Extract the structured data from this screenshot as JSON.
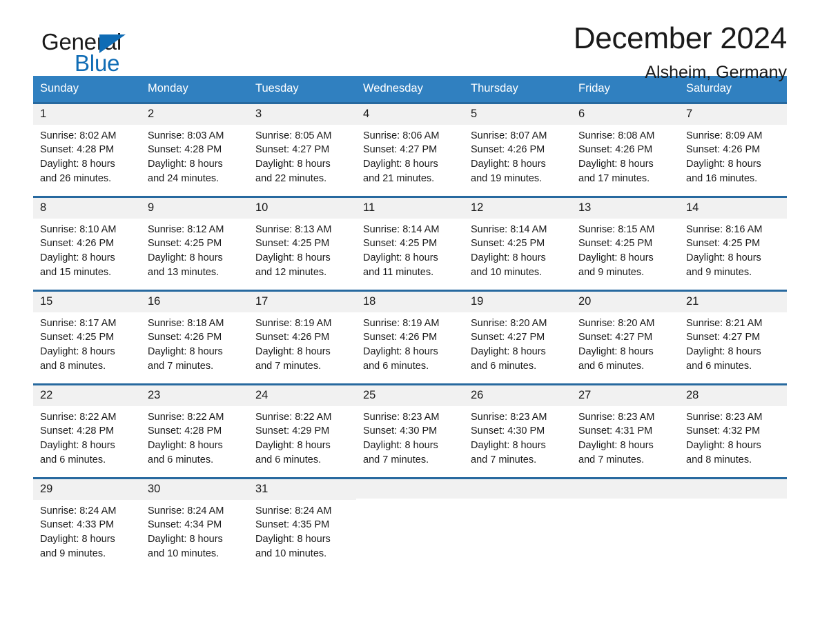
{
  "brand": {
    "name_top": "General",
    "name_bottom": "Blue",
    "accent_color": "#0f6cb5"
  },
  "header": {
    "title": "December 2024",
    "subtitle": "Alsheim, Germany"
  },
  "theme": {
    "header_row_bg": "#3080c0",
    "week_divider": "#27699f",
    "day_number_bg": "#f1f1f1",
    "text": "#1a1a1a"
  },
  "weekdays": [
    "Sunday",
    "Monday",
    "Tuesday",
    "Wednesday",
    "Thursday",
    "Friday",
    "Saturday"
  ],
  "weeks": [
    [
      {
        "day": "1",
        "sunrise": "Sunrise: 8:02 AM",
        "sunset": "Sunset: 4:28 PM",
        "daylight_l1": "Daylight: 8 hours",
        "daylight_l2": "and 26 minutes."
      },
      {
        "day": "2",
        "sunrise": "Sunrise: 8:03 AM",
        "sunset": "Sunset: 4:28 PM",
        "daylight_l1": "Daylight: 8 hours",
        "daylight_l2": "and 24 minutes."
      },
      {
        "day": "3",
        "sunrise": "Sunrise: 8:05 AM",
        "sunset": "Sunset: 4:27 PM",
        "daylight_l1": "Daylight: 8 hours",
        "daylight_l2": "and 22 minutes."
      },
      {
        "day": "4",
        "sunrise": "Sunrise: 8:06 AM",
        "sunset": "Sunset: 4:27 PM",
        "daylight_l1": "Daylight: 8 hours",
        "daylight_l2": "and 21 minutes."
      },
      {
        "day": "5",
        "sunrise": "Sunrise: 8:07 AM",
        "sunset": "Sunset: 4:26 PM",
        "daylight_l1": "Daylight: 8 hours",
        "daylight_l2": "and 19 minutes."
      },
      {
        "day": "6",
        "sunrise": "Sunrise: 8:08 AM",
        "sunset": "Sunset: 4:26 PM",
        "daylight_l1": "Daylight: 8 hours",
        "daylight_l2": "and 17 minutes."
      },
      {
        "day": "7",
        "sunrise": "Sunrise: 8:09 AM",
        "sunset": "Sunset: 4:26 PM",
        "daylight_l1": "Daylight: 8 hours",
        "daylight_l2": "and 16 minutes."
      }
    ],
    [
      {
        "day": "8",
        "sunrise": "Sunrise: 8:10 AM",
        "sunset": "Sunset: 4:26 PM",
        "daylight_l1": "Daylight: 8 hours",
        "daylight_l2": "and 15 minutes."
      },
      {
        "day": "9",
        "sunrise": "Sunrise: 8:12 AM",
        "sunset": "Sunset: 4:25 PM",
        "daylight_l1": "Daylight: 8 hours",
        "daylight_l2": "and 13 minutes."
      },
      {
        "day": "10",
        "sunrise": "Sunrise: 8:13 AM",
        "sunset": "Sunset: 4:25 PM",
        "daylight_l1": "Daylight: 8 hours",
        "daylight_l2": "and 12 minutes."
      },
      {
        "day": "11",
        "sunrise": "Sunrise: 8:14 AM",
        "sunset": "Sunset: 4:25 PM",
        "daylight_l1": "Daylight: 8 hours",
        "daylight_l2": "and 11 minutes."
      },
      {
        "day": "12",
        "sunrise": "Sunrise: 8:14 AM",
        "sunset": "Sunset: 4:25 PM",
        "daylight_l1": "Daylight: 8 hours",
        "daylight_l2": "and 10 minutes."
      },
      {
        "day": "13",
        "sunrise": "Sunrise: 8:15 AM",
        "sunset": "Sunset: 4:25 PM",
        "daylight_l1": "Daylight: 8 hours",
        "daylight_l2": "and 9 minutes."
      },
      {
        "day": "14",
        "sunrise": "Sunrise: 8:16 AM",
        "sunset": "Sunset: 4:25 PM",
        "daylight_l1": "Daylight: 8 hours",
        "daylight_l2": "and 9 minutes."
      }
    ],
    [
      {
        "day": "15",
        "sunrise": "Sunrise: 8:17 AM",
        "sunset": "Sunset: 4:25 PM",
        "daylight_l1": "Daylight: 8 hours",
        "daylight_l2": "and 8 minutes."
      },
      {
        "day": "16",
        "sunrise": "Sunrise: 8:18 AM",
        "sunset": "Sunset: 4:26 PM",
        "daylight_l1": "Daylight: 8 hours",
        "daylight_l2": "and 7 minutes."
      },
      {
        "day": "17",
        "sunrise": "Sunrise: 8:19 AM",
        "sunset": "Sunset: 4:26 PM",
        "daylight_l1": "Daylight: 8 hours",
        "daylight_l2": "and 7 minutes."
      },
      {
        "day": "18",
        "sunrise": "Sunrise: 8:19 AM",
        "sunset": "Sunset: 4:26 PM",
        "daylight_l1": "Daylight: 8 hours",
        "daylight_l2": "and 6 minutes."
      },
      {
        "day": "19",
        "sunrise": "Sunrise: 8:20 AM",
        "sunset": "Sunset: 4:27 PM",
        "daylight_l1": "Daylight: 8 hours",
        "daylight_l2": "and 6 minutes."
      },
      {
        "day": "20",
        "sunrise": "Sunrise: 8:20 AM",
        "sunset": "Sunset: 4:27 PM",
        "daylight_l1": "Daylight: 8 hours",
        "daylight_l2": "and 6 minutes."
      },
      {
        "day": "21",
        "sunrise": "Sunrise: 8:21 AM",
        "sunset": "Sunset: 4:27 PM",
        "daylight_l1": "Daylight: 8 hours",
        "daylight_l2": "and 6 minutes."
      }
    ],
    [
      {
        "day": "22",
        "sunrise": "Sunrise: 8:22 AM",
        "sunset": "Sunset: 4:28 PM",
        "daylight_l1": "Daylight: 8 hours",
        "daylight_l2": "and 6 minutes."
      },
      {
        "day": "23",
        "sunrise": "Sunrise: 8:22 AM",
        "sunset": "Sunset: 4:28 PM",
        "daylight_l1": "Daylight: 8 hours",
        "daylight_l2": "and 6 minutes."
      },
      {
        "day": "24",
        "sunrise": "Sunrise: 8:22 AM",
        "sunset": "Sunset: 4:29 PM",
        "daylight_l1": "Daylight: 8 hours",
        "daylight_l2": "and 6 minutes."
      },
      {
        "day": "25",
        "sunrise": "Sunrise: 8:23 AM",
        "sunset": "Sunset: 4:30 PM",
        "daylight_l1": "Daylight: 8 hours",
        "daylight_l2": "and 7 minutes."
      },
      {
        "day": "26",
        "sunrise": "Sunrise: 8:23 AM",
        "sunset": "Sunset: 4:30 PM",
        "daylight_l1": "Daylight: 8 hours",
        "daylight_l2": "and 7 minutes."
      },
      {
        "day": "27",
        "sunrise": "Sunrise: 8:23 AM",
        "sunset": "Sunset: 4:31 PM",
        "daylight_l1": "Daylight: 8 hours",
        "daylight_l2": "and 7 minutes."
      },
      {
        "day": "28",
        "sunrise": "Sunrise: 8:23 AM",
        "sunset": "Sunset: 4:32 PM",
        "daylight_l1": "Daylight: 8 hours",
        "daylight_l2": "and 8 minutes."
      }
    ],
    [
      {
        "day": "29",
        "sunrise": "Sunrise: 8:24 AM",
        "sunset": "Sunset: 4:33 PM",
        "daylight_l1": "Daylight: 8 hours",
        "daylight_l2": "and 9 minutes."
      },
      {
        "day": "30",
        "sunrise": "Sunrise: 8:24 AM",
        "sunset": "Sunset: 4:34 PM",
        "daylight_l1": "Daylight: 8 hours",
        "daylight_l2": "and 10 minutes."
      },
      {
        "day": "31",
        "sunrise": "Sunrise: 8:24 AM",
        "sunset": "Sunset: 4:35 PM",
        "daylight_l1": "Daylight: 8 hours",
        "daylight_l2": "and 10 minutes."
      },
      {
        "day": "",
        "sunrise": "",
        "sunset": "",
        "daylight_l1": "",
        "daylight_l2": ""
      },
      {
        "day": "",
        "sunrise": "",
        "sunset": "",
        "daylight_l1": "",
        "daylight_l2": ""
      },
      {
        "day": "",
        "sunrise": "",
        "sunset": "",
        "daylight_l1": "",
        "daylight_l2": ""
      },
      {
        "day": "",
        "sunrise": "",
        "sunset": "",
        "daylight_l1": "",
        "daylight_l2": ""
      }
    ]
  ]
}
